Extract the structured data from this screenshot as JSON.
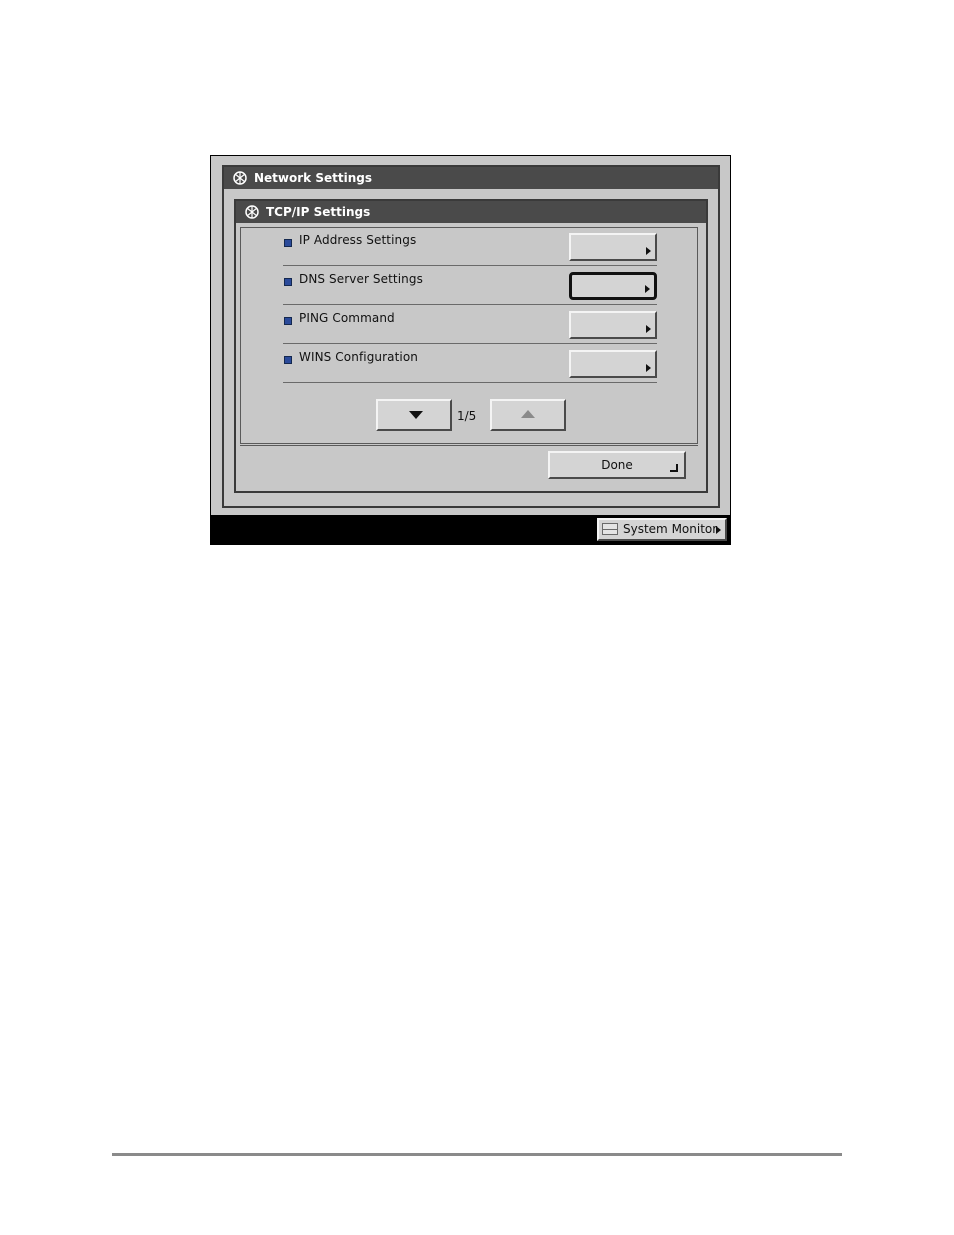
{
  "outer_window": {
    "title": "Network Settings",
    "icon": "network-settings-icon"
  },
  "inner_window": {
    "title": "TCP/IP Settings",
    "icon": "tcpip-settings-icon"
  },
  "items": [
    {
      "label": "IP Address Settings",
      "selected": false
    },
    {
      "label": "DNS Server Settings",
      "selected": true
    },
    {
      "label": "PING Command",
      "selected": false
    },
    {
      "label": "WINS Configuration",
      "selected": false
    }
  ],
  "pager": {
    "indicator": "1/5",
    "down_icon": "arrow-down-icon",
    "up_icon": "arrow-up-icon"
  },
  "done_label": "Done",
  "system_monitor_label": "System Monitor",
  "colors": {
    "bullet": "#2a4a9a",
    "titlebar": "#4a4a4a",
    "panel": "#c8c8c8"
  }
}
